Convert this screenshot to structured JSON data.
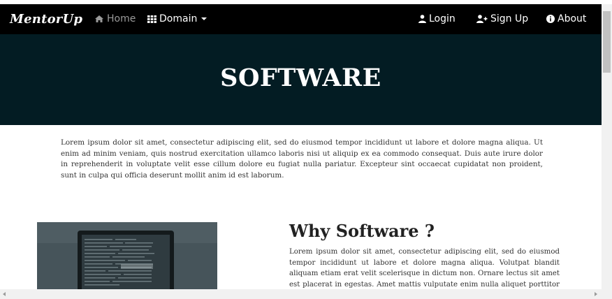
{
  "navbar": {
    "brand": "MentorUp",
    "home_label": "Home",
    "domain_label": "Domain",
    "login_label": "Login",
    "signup_label": "Sign Up",
    "about_label": "About"
  },
  "hero": {
    "title": "SOFTWARE"
  },
  "intro": {
    "text": "Lorem ipsum dolor sit amet, consectetur adipiscing elit, sed do eiusmod tempor incididunt ut labore et dolore magna aliqua. Ut enim ad minim veniam, quis nostrud exercitation ullamco laboris nisi ut aliquip ex ea commodo consequat. Duis aute irure dolor in reprehenderit in voluptate velit esse cillum dolore eu fugiat nulla pariatur. Excepteur sint occaecat cupidatat non proident, sunt in culpa qui officia deserunt mollit anim id est laborum."
  },
  "why": {
    "title": "Why Software ?",
    "text": "Lorem ipsum dolor sit amet, consectetur adipiscing elit, sed do eiusmod tempor incididunt ut labore et dolore magna aliqua. Volutpat blandit aliquam etiam erat velit scelerisque in dictum non. Ornare lectus sit amet est placerat in egestas. Amet mattis vulputate enim nulla aliquet porttitor lacus. Ipsum suspendisse"
  },
  "icons": {
    "home": "home-icon",
    "domain": "grid-icon",
    "login": "user-icon",
    "signup": "user-plus-icon",
    "about": "info-icon"
  },
  "colors": {
    "navbar_bg": "#000000",
    "hero_bg": "#031c23",
    "home_inactive": "#9a9a9a"
  }
}
